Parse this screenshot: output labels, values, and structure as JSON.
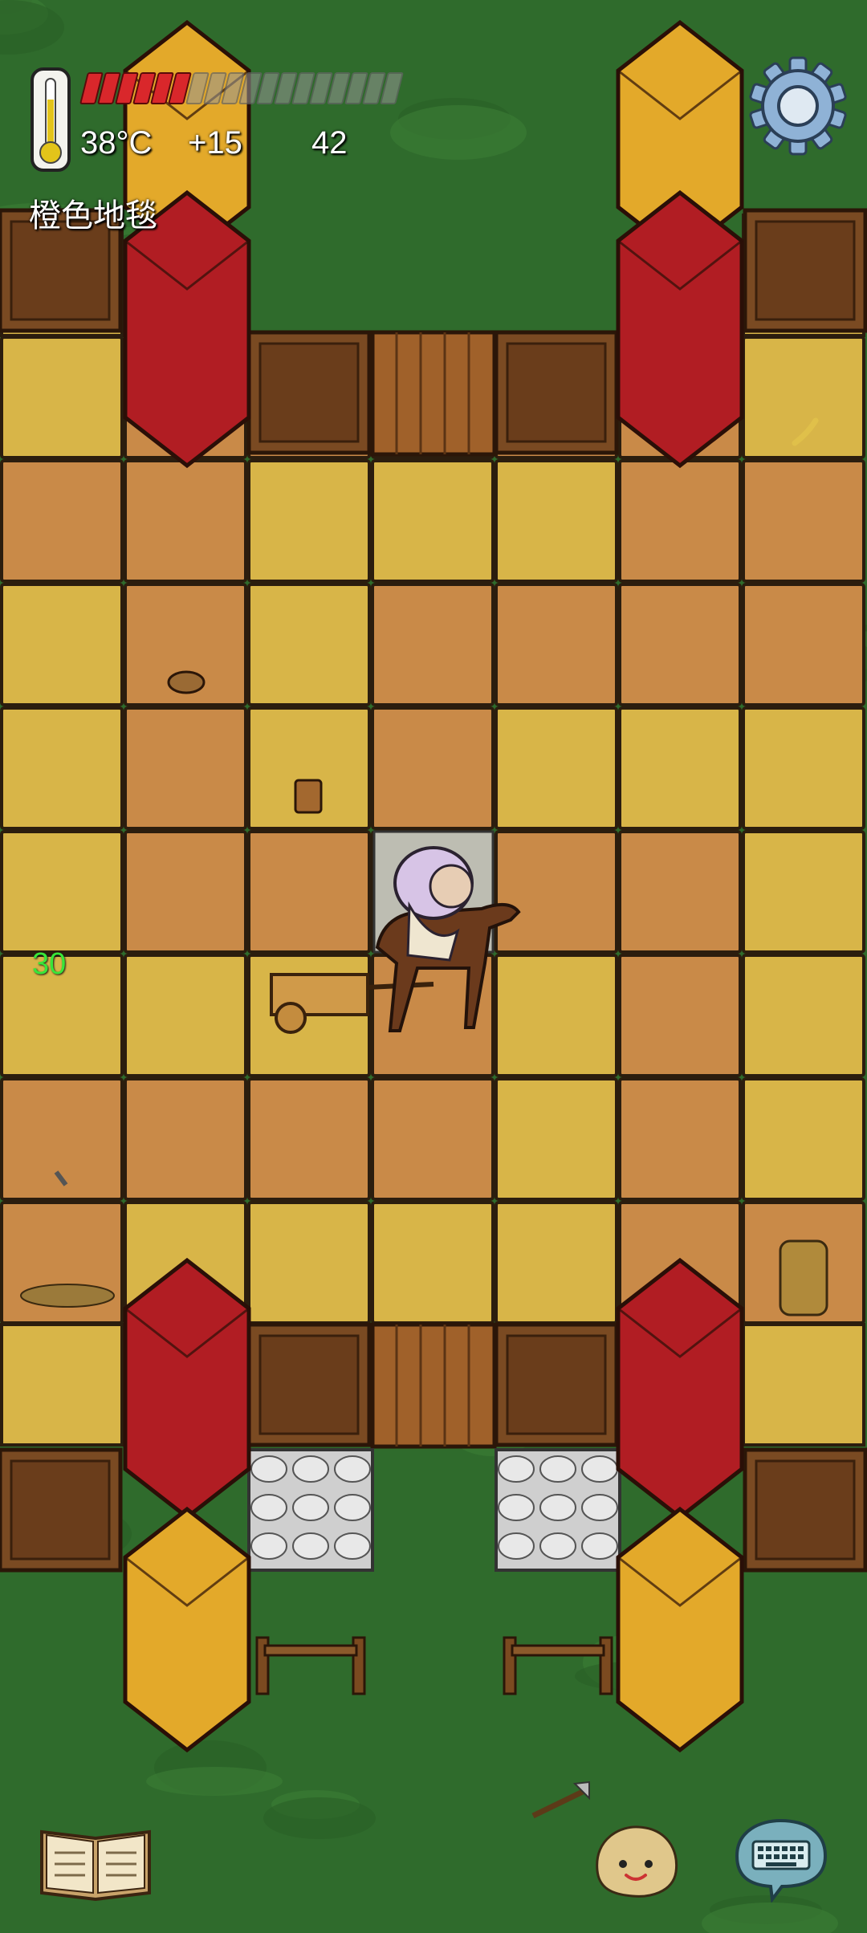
{
  "hud": {
    "temperature": "38°C",
    "bonus": "+15",
    "age": "42",
    "food_total": 18,
    "food_filled": 6,
    "item_name": "橙色地毯",
    "floating_number": "30"
  },
  "colors": {
    "grass": "#2f6b2c",
    "yellow_tile": "#d8b548",
    "orange_tile": "#c98a48",
    "red_pillar": "#b11d23",
    "gold_pillar": "#e3a92a",
    "wood_wall": "#7a4a22",
    "food_red": "#d9272b",
    "floating_text": "#39e639"
  },
  "icons": [
    "thermometer-icon",
    "gear-icon",
    "book-icon",
    "emote-face-icon",
    "keyboard-chat-icon"
  ]
}
